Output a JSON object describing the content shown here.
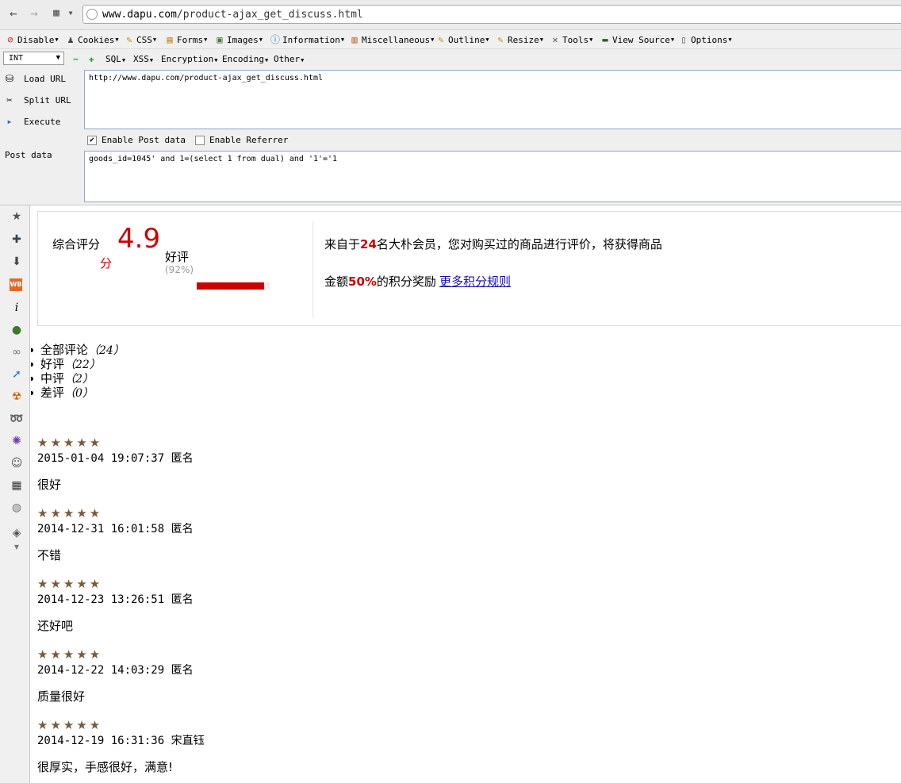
{
  "browser": {
    "url_scheme_host": "www.dapu.com",
    "url_path": "/product-ajax_get_discuss.html"
  },
  "webdev_toolbar": [
    {
      "label": "Disable",
      "icon": "no-entry-icon",
      "color": "#cc2222"
    },
    {
      "label": "Cookies",
      "icon": "person-icon",
      "color": "#444444"
    },
    {
      "label": "CSS",
      "icon": "pencil-icon",
      "color": "#c88a10"
    },
    {
      "label": "Forms",
      "icon": "clipboard-icon",
      "color": "#c08020"
    },
    {
      "label": "Images",
      "icon": "picture-icon",
      "color": "#4c7a3c"
    },
    {
      "label": "Information",
      "icon": "info-icon",
      "color": "#2a6fc9"
    },
    {
      "label": "Miscellaneous",
      "icon": "book-icon",
      "color": "#c06020"
    },
    {
      "label": "Outline",
      "icon": "pencil-icon",
      "color": "#d08a20"
    },
    {
      "label": "Resize",
      "icon": "ruler-icon",
      "color": "#d08a20"
    },
    {
      "label": "Tools",
      "icon": "wrench-icon",
      "color": "#555555"
    },
    {
      "label": "View Source",
      "icon": "terminal-icon",
      "color": "#2a5a2a"
    },
    {
      "label": "Options",
      "icon": "options-icon",
      "color": "#555555"
    }
  ],
  "hackbar": {
    "select_value": "INT",
    "menus": [
      "SQL",
      "XSS",
      "Encryption",
      "Encoding",
      "Other"
    ],
    "buttons": {
      "load": "Load URL",
      "split": "Split URL",
      "execute": "Execute"
    },
    "url_value": "http://www.dapu.com/product-ajax_get_discuss.html",
    "enable_post": "Enable Post data",
    "enable_referrer": "Enable Referrer",
    "post_label": "Post data",
    "post_value": "goods_id=1045' and 1=(select 1 from dual) and '1'='1"
  },
  "summary": {
    "score_label": "综合评分",
    "score": "4.9",
    "score_unit": "分",
    "good_label": "好评",
    "good_pct": "(92%)",
    "good_ratio": 0.92,
    "info_line1_prefix": "来自于",
    "info_line1_num": "24",
    "info_line1_suffix": "名大朴会员，您对购买过的商品进行评价，将获得商品",
    "info_line2_prefix": "金额",
    "info_line2_num": "50%",
    "info_line2_suffix": "的积分奖励",
    "more_link": "更多积分规则"
  },
  "filters": [
    {
      "label": "全部评论",
      "count": "（24）"
    },
    {
      "label": "好评",
      "count": "（22）"
    },
    {
      "label": "中评",
      "count": "（2）"
    },
    {
      "label": "差评",
      "count": "（0）"
    }
  ],
  "reviews": [
    {
      "stars": "★★★★★",
      "time": "2015-01-04 19:07:37",
      "user": "匿名",
      "text": "很好"
    },
    {
      "stars": "★★★★★",
      "time": "2014-12-31 16:01:58",
      "user": "匿名",
      "text": "不错"
    },
    {
      "stars": "★★★★★",
      "time": "2014-12-23 13:26:51",
      "user": "匿名",
      "text": "还好吧"
    },
    {
      "stars": "★★★★★",
      "time": "2014-12-22 14:03:29",
      "user": "匿名",
      "text": "质量很好"
    },
    {
      "stars": "★★★★★",
      "time": "2014-12-19 16:31:36",
      "user": "宋直钰",
      "text": "很厚实，手感很好，满意!"
    }
  ]
}
